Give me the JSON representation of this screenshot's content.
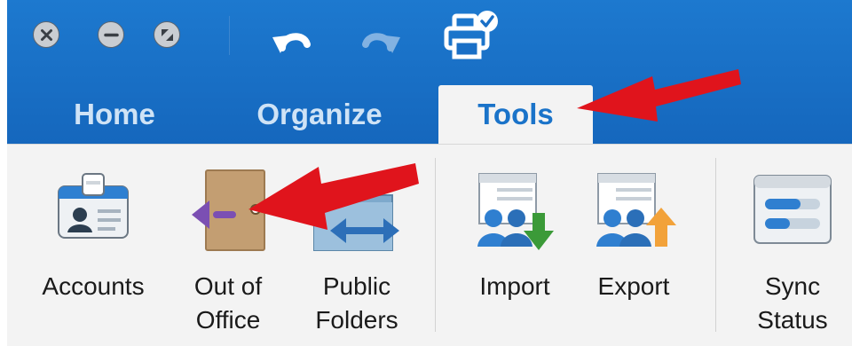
{
  "tabs": [
    {
      "label": "Home",
      "active": false
    },
    {
      "label": "Organize",
      "active": false
    },
    {
      "label": "Tools",
      "active": true
    }
  ],
  "ribbon": {
    "accounts": {
      "label": "Accounts"
    },
    "out_of_office": {
      "line1": "Out of",
      "line2": "Office"
    },
    "public_folders": {
      "line1": "Public",
      "line2": "Folders"
    },
    "import": {
      "label": "Import"
    },
    "export": {
      "label": "Export"
    },
    "sync_status": {
      "line1": "Sync",
      "line2": "Status"
    }
  },
  "colors": {
    "titlebar_blue": "#1a6fc6",
    "active_tab_text": "#1a73c9",
    "inactive_tab_text": "#cfe3f6",
    "annotation_arrow": "#e0141c"
  },
  "icons": {
    "window_controls": [
      "close-icon",
      "minimize-icon",
      "fullscreen-icon"
    ],
    "quick_access": [
      "undo-icon",
      "redo-icon",
      "print-icon"
    ]
  }
}
